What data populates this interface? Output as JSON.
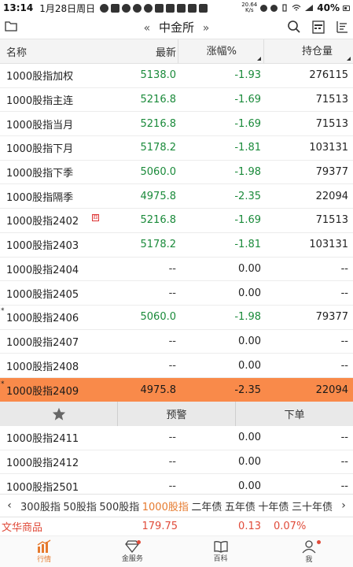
{
  "statusbar": {
    "time": "13:14",
    "date": "1月28日周日",
    "net_speed_top": "20.64",
    "net_speed_unit": "K/s",
    "battery": "40%"
  },
  "topnav": {
    "title": "中金所",
    "prev_arrow": "«",
    "next_arrow": "»"
  },
  "table": {
    "headers": {
      "name": "名称",
      "last": "最新",
      "change": "涨幅%",
      "open_interest": "持仓量"
    },
    "rows": [
      {
        "name": "1000股指加权",
        "last": "5138.0",
        "change": "-1.93",
        "oi": "276115",
        "star": false,
        "badge": false
      },
      {
        "name": "1000股指主连",
        "last": "5216.8",
        "change": "-1.69",
        "oi": "71513",
        "star": false,
        "badge": false
      },
      {
        "name": "1000股指当月",
        "last": "5216.8",
        "change": "-1.69",
        "oi": "71513",
        "star": false,
        "badge": false
      },
      {
        "name": "1000股指下月",
        "last": "5178.2",
        "change": "-1.81",
        "oi": "103131",
        "star": false,
        "badge": false
      },
      {
        "name": "1000股指下季",
        "last": "5060.0",
        "change": "-1.98",
        "oi": "79377",
        "star": false,
        "badge": false
      },
      {
        "name": "1000股指隔季",
        "last": "4975.8",
        "change": "-2.35",
        "oi": "22094",
        "star": false,
        "badge": false
      },
      {
        "name": "1000股指2402",
        "last": "5216.8",
        "change": "-1.69",
        "oi": "71513",
        "star": false,
        "badge": true
      },
      {
        "name": "1000股指2403",
        "last": "5178.2",
        "change": "-1.81",
        "oi": "103131",
        "star": false,
        "badge": false
      },
      {
        "name": "1000股指2404",
        "last": "--",
        "change": "0.00",
        "oi": "--",
        "star": false,
        "badge": false
      },
      {
        "name": "1000股指2405",
        "last": "--",
        "change": "0.00",
        "oi": "--",
        "star": false,
        "badge": false
      },
      {
        "name": "1000股指2406",
        "last": "5060.0",
        "change": "-1.98",
        "oi": "79377",
        "star": true,
        "badge": false
      },
      {
        "name": "1000股指2407",
        "last": "--",
        "change": "0.00",
        "oi": "--",
        "star": false,
        "badge": false
      },
      {
        "name": "1000股指2408",
        "last": "--",
        "change": "0.00",
        "oi": "--",
        "star": false,
        "badge": false
      },
      {
        "name": "1000股指2409",
        "last": "4975.8",
        "change": "-2.35",
        "oi": "22094",
        "star": true,
        "badge": false
      }
    ],
    "rows_after": [
      {
        "name": "1000股指2411",
        "last": "--",
        "change": "0.00",
        "oi": "--"
      },
      {
        "name": "1000股指2412",
        "last": "--",
        "change": "0.00",
        "oi": "--"
      },
      {
        "name": "1000股指2501",
        "last": "--",
        "change": "0.00",
        "oi": "--"
      }
    ],
    "badge_char": "四",
    "star_char": "*"
  },
  "actionbar": {
    "warn_label": "预警",
    "order_label": "下单"
  },
  "tabs": {
    "items": [
      "300股指",
      "50股指",
      "500股指",
      "1000股指",
      "二年债",
      "五年债",
      "十年债",
      "三十年债"
    ],
    "active_index": 3
  },
  "ticker": {
    "name": "文华商品",
    "price": "179.75",
    "change": "0.13",
    "pct": "0.07%"
  },
  "bottomnav": {
    "items": [
      {
        "label": "行情",
        "icon": "chart-icon"
      },
      {
        "label": "金服务",
        "icon": "diamond-icon"
      },
      {
        "label": "百科",
        "icon": "book-icon"
      },
      {
        "label": "我",
        "icon": "user-icon"
      }
    ]
  },
  "colors": {
    "accent": "#e67a2e",
    "selected_row": "#f98a4a",
    "up_green": "#1a8a3a",
    "ticker_red": "#e04b3a"
  }
}
